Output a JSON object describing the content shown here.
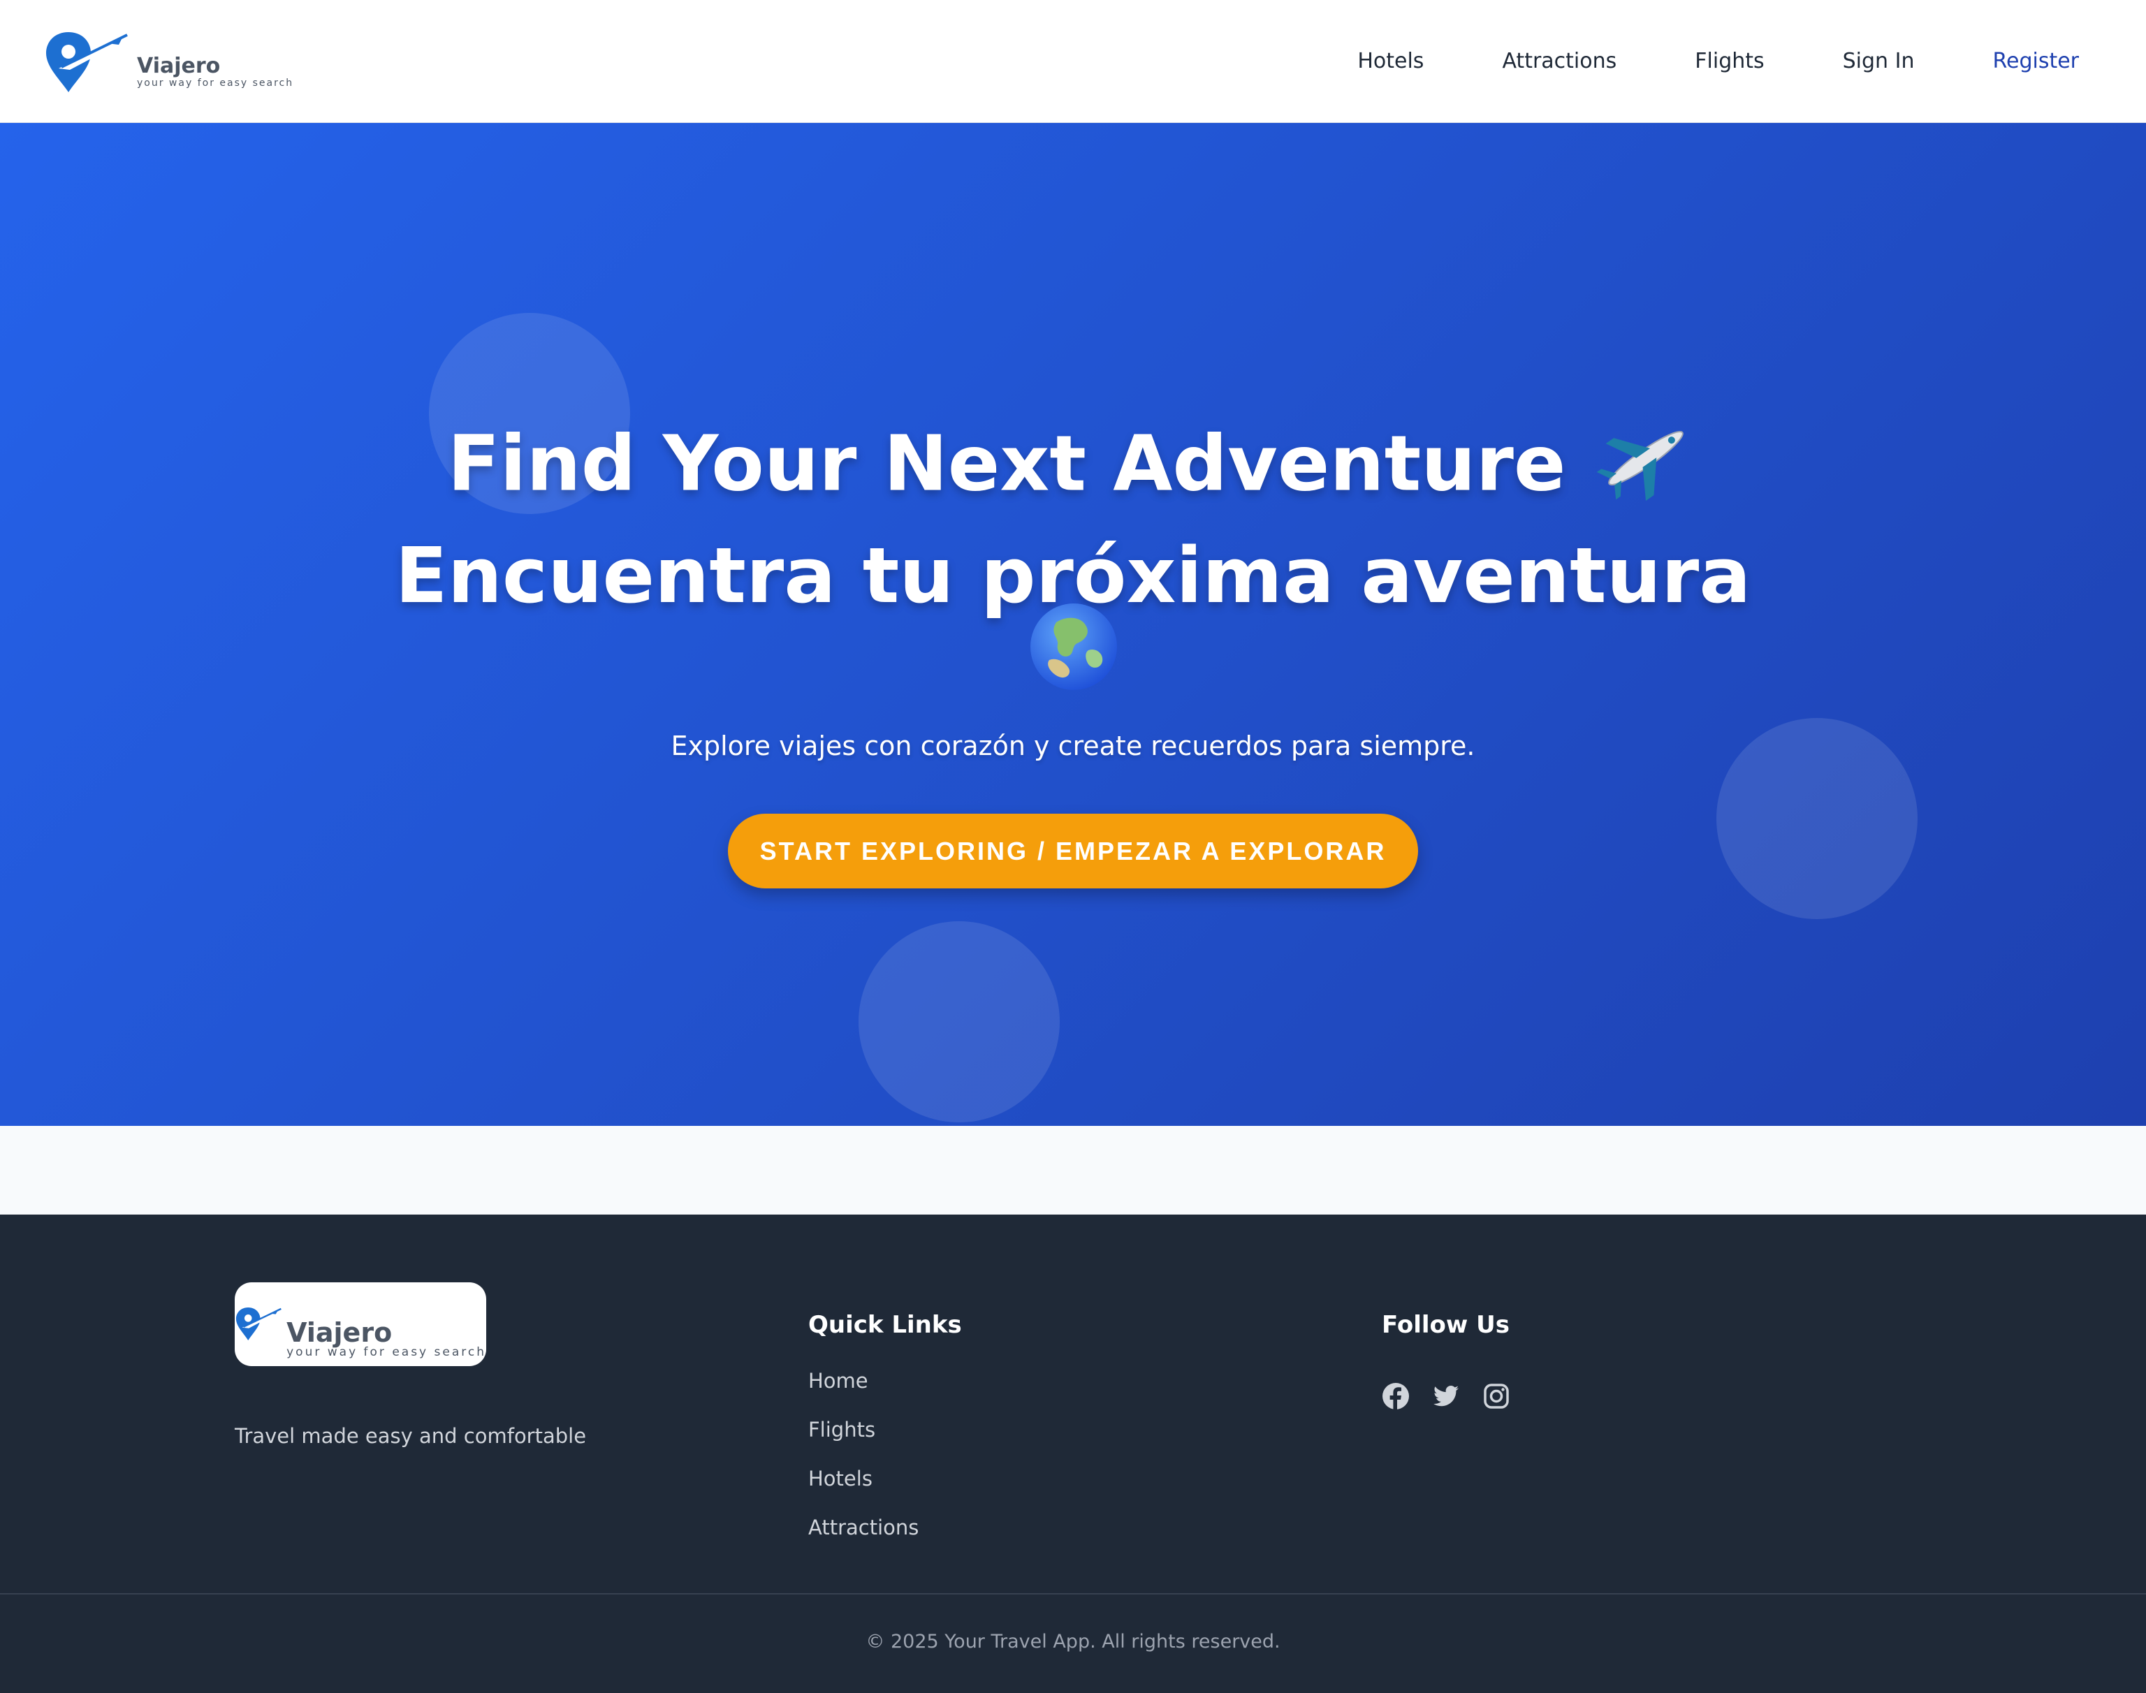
{
  "brand": {
    "name": "Viajero",
    "tagline": "your way for easy search"
  },
  "nav": {
    "items": [
      {
        "label": "Hotels"
      },
      {
        "label": "Attractions"
      },
      {
        "label": "Flights"
      },
      {
        "label": "Sign In"
      }
    ],
    "register": "Register"
  },
  "hero": {
    "title_en": "Find Your Next Adventure",
    "title_es": "Encuentra tu próxima aventura",
    "emoji_1": "airplane-icon",
    "emoji_2": "globe-icon",
    "subtitle": "Explore viajes con corazón y create recuerdos para siempre.",
    "cta": "START EXPLORING / EMPEZAR A EXPLORAR"
  },
  "footer": {
    "tagline": "Travel made easy and comfortable",
    "quick_links_heading": "Quick Links",
    "quick_links": [
      {
        "label": "Home"
      },
      {
        "label": "Flights"
      },
      {
        "label": "Hotels"
      },
      {
        "label": "Attractions"
      }
    ],
    "follow_heading": "Follow Us",
    "social": [
      "facebook-icon",
      "twitter-icon",
      "instagram-icon"
    ],
    "copyright": "© 2025 Your Travel App. All rights reserved."
  },
  "colors": {
    "hero_start": "#2563eb",
    "hero_end": "#1e40af",
    "cta": "#f59e0b",
    "footer_bg": "#1f2937",
    "register_link": "#1e40af"
  }
}
